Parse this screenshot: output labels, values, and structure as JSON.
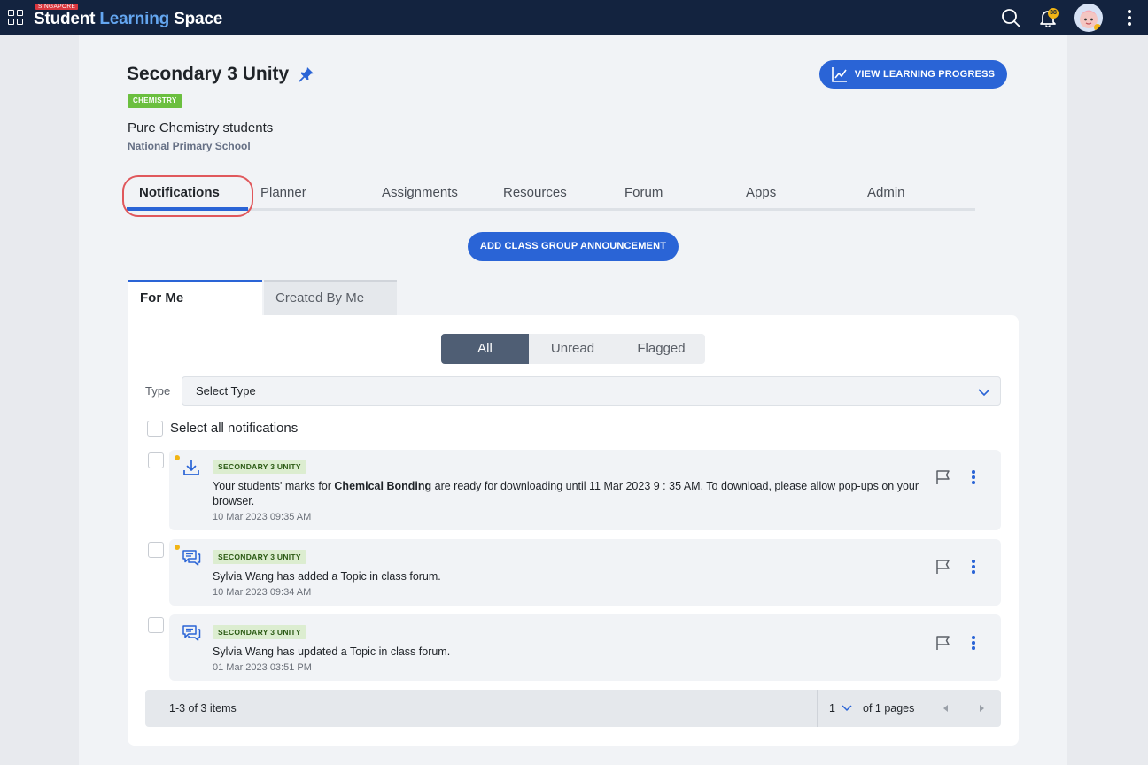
{
  "app": {
    "brand_tag": "SINGAPORE",
    "brand_part1": "Student",
    "brand_part2": "Learning",
    "brand_part3": "Space",
    "notification_count": "38"
  },
  "header": {
    "title": "Secondary 3 Unity",
    "subject": "CHEMISTRY",
    "description": "Pure Chemistry students",
    "school": "National Primary School",
    "progress_button": "VIEW LEARNING PROGRESS"
  },
  "tabs": [
    {
      "label": "Notifications",
      "active": true
    },
    {
      "label": "Planner"
    },
    {
      "label": "Assignments"
    },
    {
      "label": "Resources"
    },
    {
      "label": "Forum"
    },
    {
      "label": "Apps"
    },
    {
      "label": "Admin"
    }
  ],
  "announce_button": "ADD CLASS GROUP ANNOUNCEMENT",
  "subtabs": {
    "for_me": "For Me",
    "created_by_me": "Created By Me"
  },
  "filter": {
    "all": "All",
    "unread": "Unread",
    "flagged": "Flagged",
    "selected": "All"
  },
  "type_filter": {
    "label": "Type",
    "value": "Select Type"
  },
  "select_all_label": "Select all notifications",
  "notifications": [
    {
      "icon": "download-icon",
      "unread": true,
      "class_tag": "SECONDARY 3 UNITY",
      "text_before": "Your students' marks for ",
      "text_bold": "Chemical Bonding",
      "text_after": " are ready for downloading until 11 Mar 2023 9 : 35 AM. To download, please allow pop-ups on your browser.",
      "time": "10 Mar 2023 09:35 AM"
    },
    {
      "icon": "forum-icon",
      "unread": true,
      "class_tag": "SECONDARY 3 UNITY",
      "text": "Sylvia Wang has added a Topic in class forum.",
      "time": "10 Mar 2023 09:34 AM"
    },
    {
      "icon": "forum-icon",
      "unread": false,
      "class_tag": "SECONDARY 3 UNITY",
      "text": "Sylvia Wang has updated a Topic in class forum.",
      "time": "01 Mar 2023 03:51 PM"
    }
  ],
  "pagination": {
    "count": "1-3 of 3 items",
    "page": "1",
    "of_pages": "of 1 pages"
  },
  "colors": {
    "topbar": "#13233f",
    "primary": "#2a64d6",
    "subject_chip": "#6bbf3f",
    "unread_dot": "#f1b414",
    "highlight_ring": "#e0585c"
  }
}
